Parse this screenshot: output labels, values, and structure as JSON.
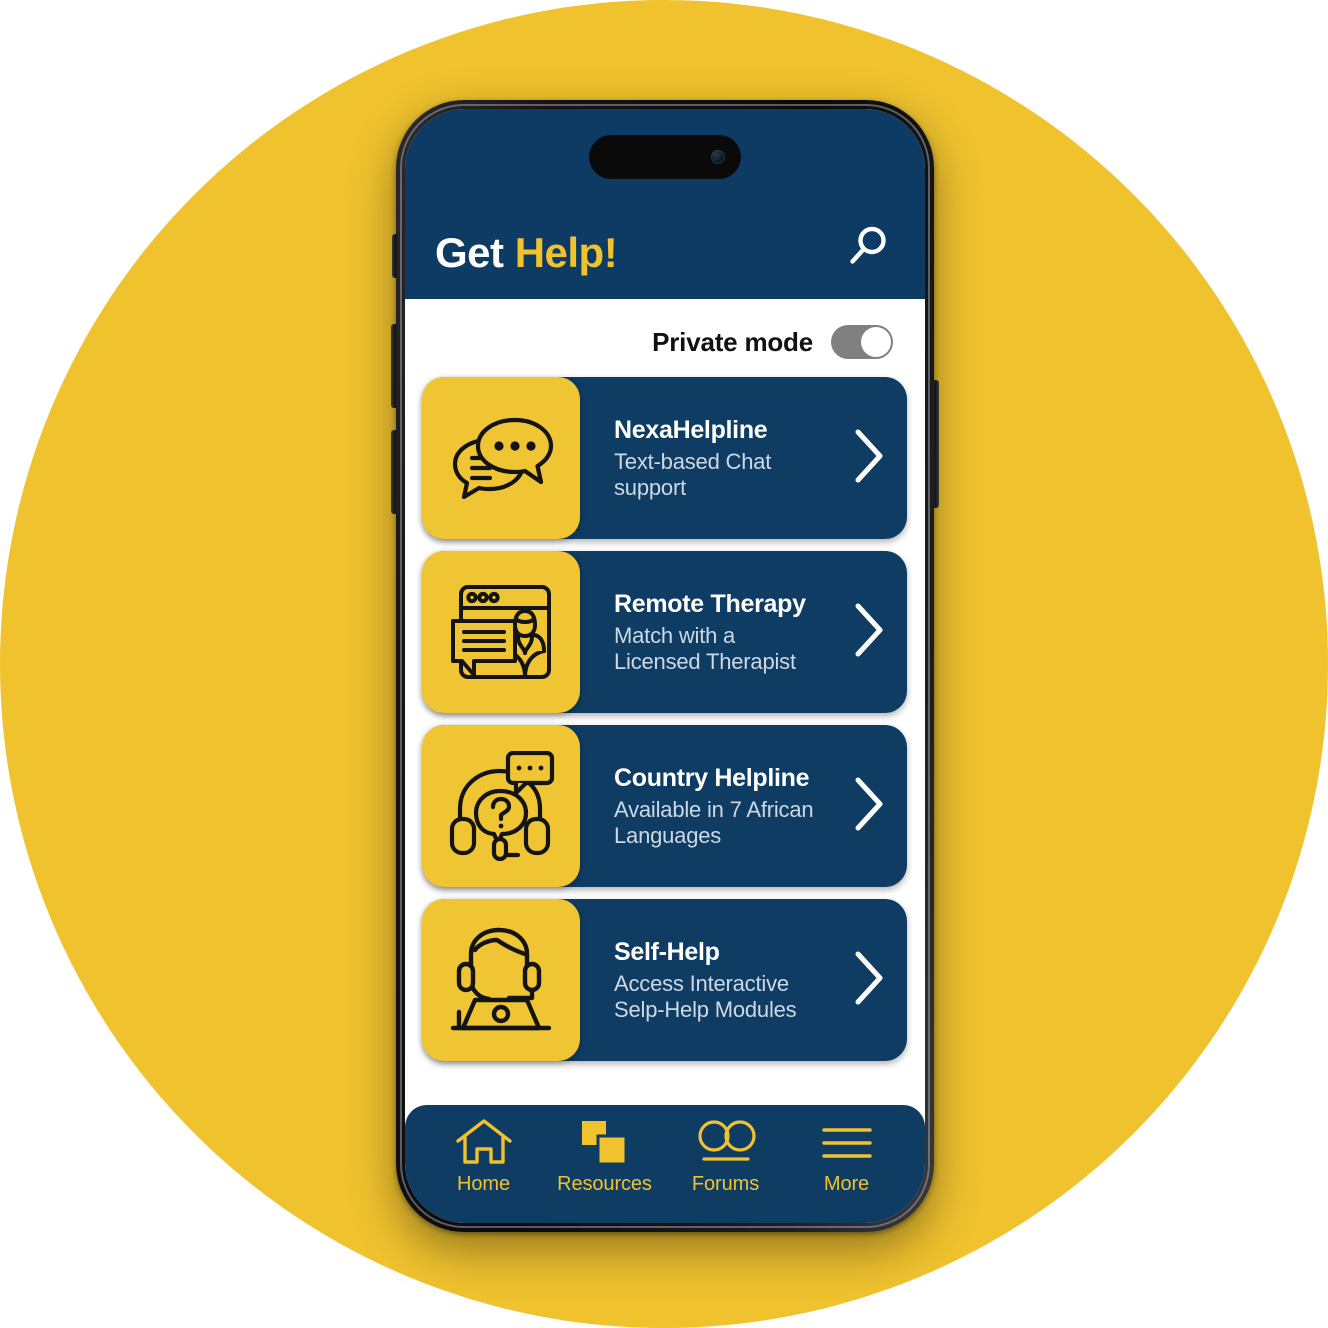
{
  "background": {
    "circle_color": "#EFC22E",
    "page_color": "#FFFFFF"
  },
  "device": {
    "frame_color": "#141416",
    "island_name": "dynamic-island"
  },
  "theme": {
    "brand_blue": "#0D3B63",
    "card_blue": "#0F3C63",
    "brand_yellow": "#EFC22E",
    "tile_yellow": "#F0C534",
    "toggle_track": "#808080",
    "toggle_knob": "#FFFFFF"
  },
  "header": {
    "title_part1": "Get ",
    "title_part2": "Help!",
    "search_icon": "search-icon"
  },
  "private_mode": {
    "label": "Private mode",
    "state": "on",
    "knob_position": "right"
  },
  "cards": [
    {
      "icon": "chat-bubbles-icon",
      "title": "NexaHelpline",
      "subtitle_line1": "Text-based Chat",
      "subtitle_line2": "support",
      "chevron": "chevron-right-icon"
    },
    {
      "icon": "video-therapy-window-icon",
      "title": "Remote Therapy",
      "subtitle_line1": "Match with a",
      "subtitle_line2": "Licensed Therapist",
      "chevron": "chevron-right-icon"
    },
    {
      "icon": "headset-question-icon",
      "title": "Country Helpline",
      "subtitle_line1": "Available in 7 African",
      "subtitle_line2": "Languages",
      "chevron": "chevron-right-icon"
    },
    {
      "icon": "person-laptop-headset-icon",
      "title": "Self-Help",
      "subtitle_line1": "Access Interactive",
      "subtitle_line2": "Selp-Help Modules",
      "chevron": "chevron-right-icon"
    }
  ],
  "bottom_nav": [
    {
      "label": "Home",
      "icon": "home-icon"
    },
    {
      "label": "Resources",
      "icon": "squares-icon"
    },
    {
      "label": "Forums",
      "icon": "two-circles-icon"
    },
    {
      "label": "More",
      "icon": "hamburger-icon"
    }
  ]
}
